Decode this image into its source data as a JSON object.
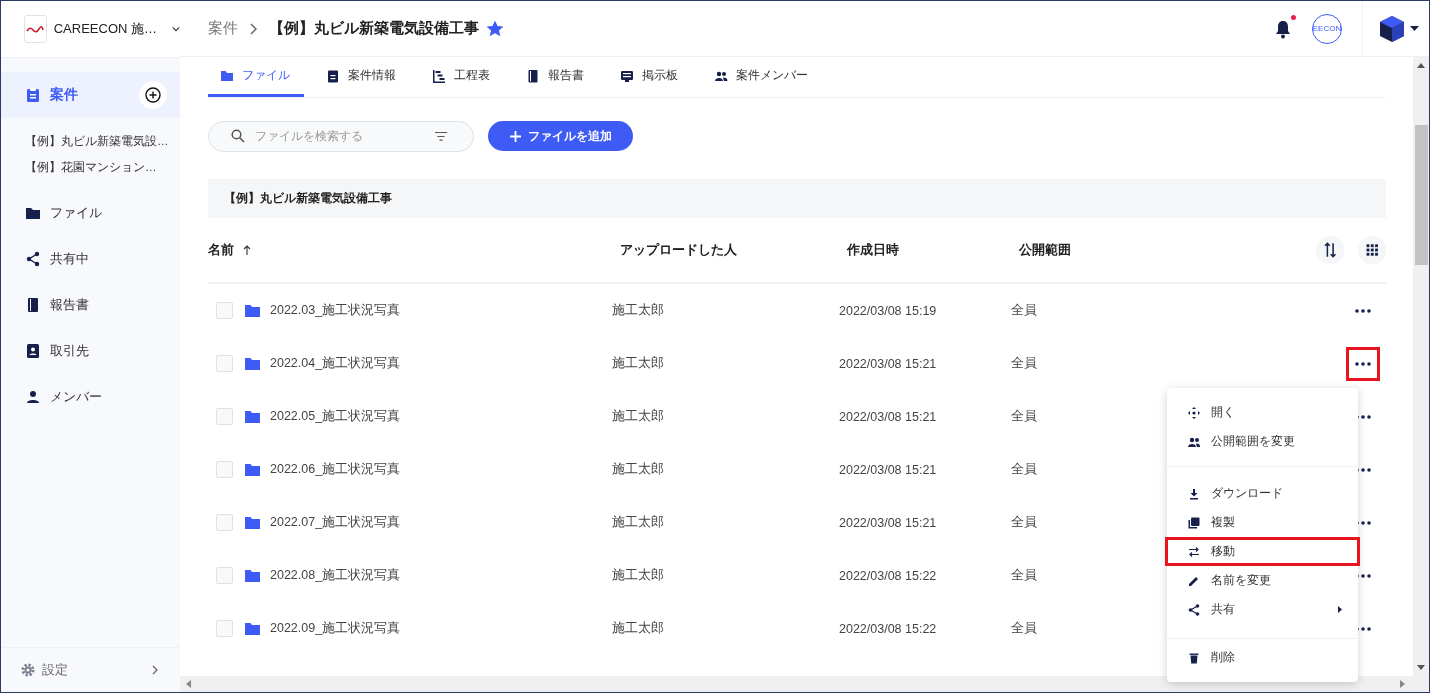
{
  "workspace": {
    "name": "CAREECON 施…"
  },
  "sidebar": {
    "items": [
      {
        "label": "案件",
        "selected": true,
        "children": [
          {
            "label": "【例】丸ビル新築電気設…"
          },
          {
            "label": "【例】花園マンション…"
          }
        ]
      },
      {
        "label": "ファイル",
        "selected": false
      },
      {
        "label": "共有中",
        "selected": false
      },
      {
        "label": "報告書",
        "selected": false
      },
      {
        "label": "取引先",
        "selected": false
      },
      {
        "label": "メンバー",
        "selected": false
      }
    ],
    "settings": "設定"
  },
  "breadcrumb": {
    "parent": "案件",
    "current": "【例】丸ビル新築電気設備工事",
    "starred": true
  },
  "header": {
    "unread_notifications": true,
    "account": "EECON"
  },
  "tabs": [
    {
      "label": "ファイル",
      "selected": true
    },
    {
      "label": "案件情報",
      "selected": false
    },
    {
      "label": "工程表",
      "selected": false
    },
    {
      "label": "報告書",
      "selected": false
    },
    {
      "label": "掲示板",
      "selected": false
    },
    {
      "label": "案件メンバー",
      "selected": false
    }
  ],
  "search": {
    "placeholder": "ファイルを検索する"
  },
  "add_button": "ファイルを追加",
  "folder_title": "【例】丸ビル新築電気設備工事",
  "table": {
    "columns": [
      "名前",
      "アップロードした人",
      "作成日時",
      "公開範囲"
    ],
    "rows": [
      {
        "name": "2022.03_施工状況写真",
        "uploader": "施工太郎",
        "created": "2022/03/08 15:19",
        "visibility": "全員",
        "checked": false,
        "highlighted": false
      },
      {
        "name": "2022.04_施工状況写真",
        "uploader": "施工太郎",
        "created": "2022/03/08 15:21",
        "visibility": "全員",
        "checked": false,
        "highlighted": true
      },
      {
        "name": "2022.05_施工状況写真",
        "uploader": "施工太郎",
        "created": "2022/03/08 15:21",
        "visibility": "全員",
        "checked": false,
        "highlighted": false
      },
      {
        "name": "2022.06_施工状況写真",
        "uploader": "施工太郎",
        "created": "2022/03/08 15:21",
        "visibility": "全員",
        "checked": false,
        "highlighted": false
      },
      {
        "name": "2022.07_施工状況写真",
        "uploader": "施工太郎",
        "created": "2022/03/08 15:21",
        "visibility": "全員",
        "checked": false,
        "highlighted": false
      },
      {
        "name": "2022.08_施工状況写真",
        "uploader": "施工太郎",
        "created": "2022/03/08 15:22",
        "visibility": "全員",
        "checked": false,
        "highlighted": false
      },
      {
        "name": "2022.09_施工状況写真",
        "uploader": "施工太郎",
        "created": "2022/03/08 15:22",
        "visibility": "全員",
        "checked": false,
        "highlighted": false
      }
    ]
  },
  "context_menu": {
    "groups": [
      [
        {
          "label": "開く",
          "highlighted": false,
          "submenu": false
        },
        {
          "label": "公開範囲を変更",
          "highlighted": false,
          "submenu": false
        }
      ],
      [
        {
          "label": "ダウンロード",
          "highlighted": false,
          "submenu": false
        },
        {
          "label": "複製",
          "highlighted": false,
          "submenu": false
        },
        {
          "label": "移動",
          "highlighted": true,
          "submenu": false
        },
        {
          "label": "名前を変更",
          "highlighted": false,
          "submenu": false
        },
        {
          "label": "共有",
          "highlighted": false,
          "submenu": true
        }
      ],
      [
        {
          "label": "削除",
          "highlighted": false,
          "submenu": false
        }
      ]
    ]
  }
}
